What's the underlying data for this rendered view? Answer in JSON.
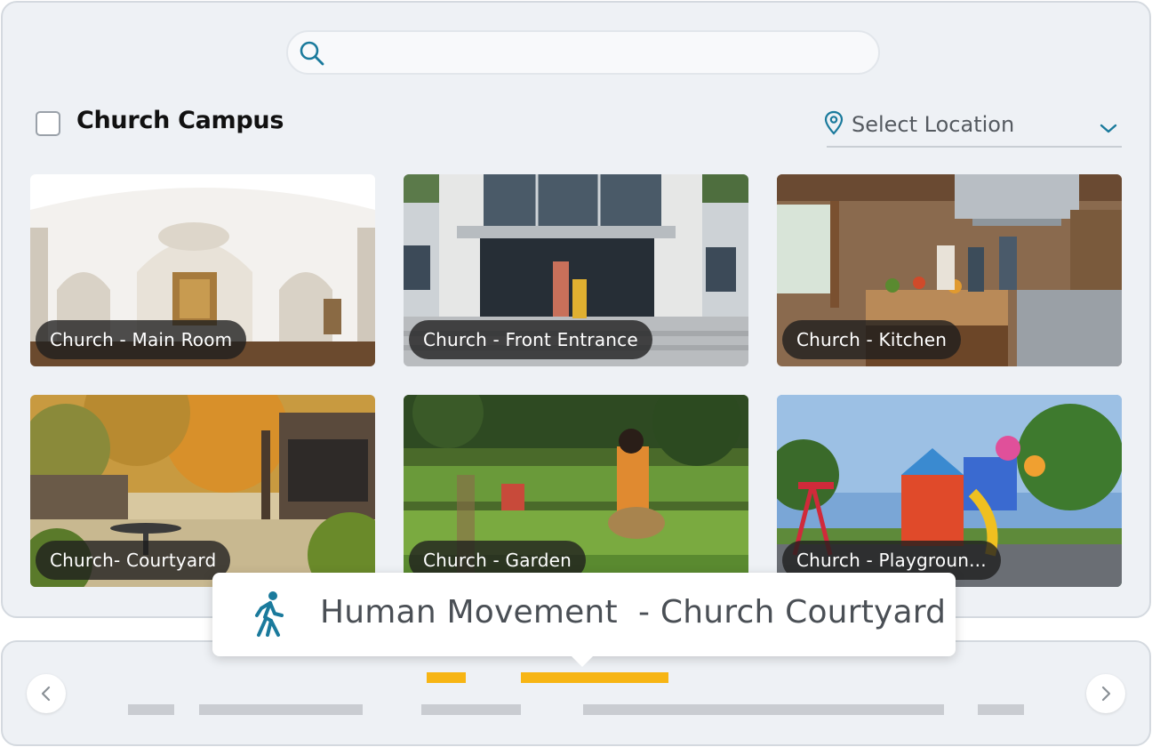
{
  "search": {
    "placeholder": "",
    "value": ""
  },
  "header": {
    "campus_label": "Church Campus",
    "checkbox_checked": false
  },
  "location_select": {
    "label": "Select Location"
  },
  "cards": [
    {
      "caption": "Church -  Main Room"
    },
    {
      "caption": "Church - Front Entrance"
    },
    {
      "caption": "Church - Kitchen"
    },
    {
      "caption": "Church- Courtyard"
    },
    {
      "caption": "Church - Garden"
    },
    {
      "caption": "Church - Playgroun..."
    }
  ],
  "tooltip": {
    "icon": "walking-person-icon",
    "text": "Human Movement  - Church Courtyard"
  },
  "timeline": {
    "prev_icon": "chevron-left-icon",
    "next_icon": "chevron-right-icon"
  },
  "colors": {
    "accent": "#1a7a9c",
    "event_bar": "#f7b514",
    "track_bar": "#c9ccd1"
  }
}
